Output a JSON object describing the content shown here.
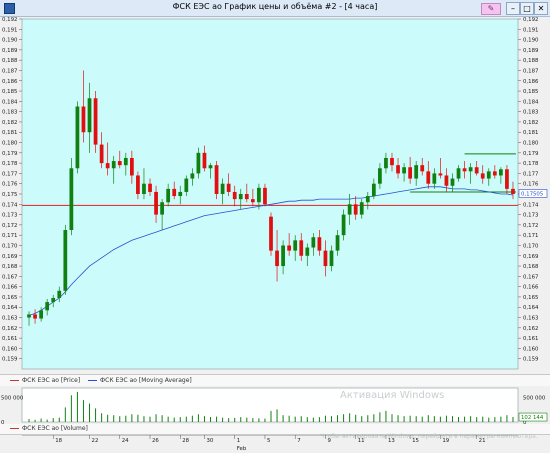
{
  "window": {
    "title": "ФСК ЕЭС ао График цены и объёма #2 - [4 часа]"
  },
  "toolbar": {
    "pen_icon": "pen-icon",
    "minimize": "–",
    "maximize": "□",
    "close": "✕"
  },
  "legend": {
    "price_label": "ФСК ЕЭС ао [Price]",
    "ma_label": "ФСК ЕЭС ао [Moving Average]",
    "volume_label": "ФСК ЕЭС ао [Volume]",
    "price_color": "#c0392b",
    "ma_color": "#2a4fd1"
  },
  "watermark": {
    "line1": "Активация Windows",
    "line2": "Чтобы активировать Windows, перейдите в параметры компьютера."
  },
  "colors": {
    "plot_bg": "#ccfbfb",
    "up": "#108010",
    "down": "#e01010",
    "level_red": "#e02020",
    "level_green": "#108010"
  },
  "chart_data": {
    "type": "candlestick",
    "ylim": [
      0.158,
      0.192
    ],
    "y_ticks": [
      "0,192",
      "0,191",
      "0,190",
      "0,189",
      "0,188",
      "0,187",
      "0,186",
      "0,185",
      "0,184",
      "0,183",
      "0,182",
      "0,181",
      "0,180",
      "0,179",
      "0,178",
      "0,177",
      "0,176",
      "0,175",
      "0,174",
      "0,173",
      "0,172",
      "0,171",
      "0,170",
      "0,169",
      "0,168",
      "0,167",
      "0,166",
      "0,165",
      "0,164",
      "0,163",
      "0,162",
      "0,161",
      "0,160",
      "0,159"
    ],
    "last_price_label": "0,17505",
    "horizontal_line_red": 0.1739,
    "green_levels": [
      {
        "from_index": 72,
        "to_index": 88,
        "value": 0.1789
      },
      {
        "from_index": 63,
        "to_index": 88,
        "value": 0.1752
      }
    ],
    "ohlc": [
      [
        0.163,
        0.1636,
        0.1622,
        0.1633
      ],
      [
        0.1633,
        0.1638,
        0.1624,
        0.1629
      ],
      [
        0.1629,
        0.164,
        0.1626,
        0.1637
      ],
      [
        0.1637,
        0.1648,
        0.1632,
        0.1645
      ],
      [
        0.1645,
        0.1652,
        0.164,
        0.1649
      ],
      [
        0.1649,
        0.166,
        0.1645,
        0.1656
      ],
      [
        0.1656,
        0.172,
        0.1652,
        0.1715
      ],
      [
        0.1715,
        0.1785,
        0.171,
        0.1775
      ],
      [
        0.1775,
        0.184,
        0.177,
        0.1835
      ],
      [
        0.1835,
        0.187,
        0.18,
        0.181
      ],
      [
        0.181,
        0.1858,
        0.179,
        0.1843
      ],
      [
        0.1843,
        0.185,
        0.179,
        0.1798
      ],
      [
        0.1798,
        0.181,
        0.1775,
        0.178
      ],
      [
        0.178,
        0.18,
        0.1768,
        0.1775
      ],
      [
        0.1775,
        0.1787,
        0.176,
        0.1782
      ],
      [
        0.1782,
        0.1792,
        0.1775,
        0.1778
      ],
      [
        0.1778,
        0.179,
        0.1768,
        0.1785
      ],
      [
        0.1785,
        0.1792,
        0.176,
        0.1768
      ],
      [
        0.1768,
        0.1772,
        0.1745,
        0.175
      ],
      [
        0.175,
        0.1775,
        0.1745,
        0.176
      ],
      [
        0.176,
        0.1765,
        0.1748,
        0.1752
      ],
      [
        0.1752,
        0.1758,
        0.1722,
        0.173
      ],
      [
        0.173,
        0.1745,
        0.1715,
        0.1742
      ],
      [
        0.1742,
        0.176,
        0.1738,
        0.1755
      ],
      [
        0.1755,
        0.1762,
        0.1745,
        0.1748
      ],
      [
        0.1748,
        0.1758,
        0.174,
        0.1752
      ],
      [
        0.1752,
        0.1768,
        0.1748,
        0.1765
      ],
      [
        0.1765,
        0.1775,
        0.1758,
        0.177
      ],
      [
        0.177,
        0.1795,
        0.1765,
        0.179
      ],
      [
        0.179,
        0.1797,
        0.1772,
        0.1775
      ],
      [
        0.1775,
        0.178,
        0.1765,
        0.1778
      ],
      [
        0.1778,
        0.1782,
        0.1745,
        0.175
      ],
      [
        0.175,
        0.1765,
        0.174,
        0.176
      ],
      [
        0.176,
        0.177,
        0.1748,
        0.1752
      ],
      [
        0.1752,
        0.1758,
        0.1738,
        0.1745
      ],
      [
        0.1745,
        0.1755,
        0.1735,
        0.175
      ],
      [
        0.175,
        0.176,
        0.1742,
        0.1745
      ],
      [
        0.1745,
        0.1755,
        0.1738,
        0.1742
      ],
      [
        0.1742,
        0.176,
        0.1735,
        0.1756
      ],
      [
        0.1756,
        0.176,
        0.1738,
        0.174
      ],
      [
        0.1728,
        0.1732,
        0.169,
        0.1695
      ],
      [
        0.1695,
        0.1715,
        0.1665,
        0.168
      ],
      [
        0.168,
        0.1705,
        0.1672,
        0.17
      ],
      [
        0.17,
        0.1712,
        0.169,
        0.1695
      ],
      [
        0.1695,
        0.171,
        0.1685,
        0.1705
      ],
      [
        0.1705,
        0.1712,
        0.1685,
        0.169
      ],
      [
        0.169,
        0.1702,
        0.168,
        0.1698
      ],
      [
        0.1698,
        0.1712,
        0.169,
        0.1708
      ],
      [
        0.1708,
        0.1715,
        0.169,
        0.1695
      ],
      [
        0.1695,
        0.1705,
        0.167,
        0.168
      ],
      [
        0.168,
        0.17,
        0.1675,
        0.1695
      ],
      [
        0.1695,
        0.1715,
        0.169,
        0.171
      ],
      [
        0.171,
        0.1735,
        0.1705,
        0.173
      ],
      [
        0.173,
        0.175,
        0.172,
        0.174
      ],
      [
        0.174,
        0.1748,
        0.1725,
        0.173
      ],
      [
        0.173,
        0.1745,
        0.1726,
        0.1742
      ],
      [
        0.1742,
        0.1752,
        0.1735,
        0.1748
      ],
      [
        0.1748,
        0.1765,
        0.1745,
        0.176
      ],
      [
        0.176,
        0.178,
        0.1755,
        0.1775
      ],
      [
        0.1775,
        0.179,
        0.177,
        0.1785
      ],
      [
        0.1785,
        0.179,
        0.1772,
        0.1778
      ],
      [
        0.1778,
        0.1785,
        0.1765,
        0.177
      ],
      [
        0.177,
        0.178,
        0.1762,
        0.1776
      ],
      [
        0.1776,
        0.1786,
        0.176,
        0.1765
      ],
      [
        0.1765,
        0.1782,
        0.1758,
        0.1778
      ],
      [
        0.1778,
        0.1785,
        0.1768,
        0.1772
      ],
      [
        0.1772,
        0.1782,
        0.1755,
        0.176
      ],
      [
        0.176,
        0.1775,
        0.1755,
        0.177
      ],
      [
        0.177,
        0.1785,
        0.1765,
        0.1768
      ],
      [
        0.1768,
        0.1775,
        0.1752,
        0.1758
      ],
      [
        0.1758,
        0.177,
        0.1752,
        0.1765
      ],
      [
        0.1765,
        0.1778,
        0.1762,
        0.1775
      ],
      [
        0.1775,
        0.1782,
        0.1765,
        0.1772
      ],
      [
        0.1772,
        0.178,
        0.176,
        0.1776
      ],
      [
        0.1776,
        0.1782,
        0.1768,
        0.177
      ],
      [
        0.177,
        0.1778,
        0.176,
        0.1765
      ],
      [
        0.1765,
        0.1775,
        0.1758,
        0.1772
      ],
      [
        0.1772,
        0.1778,
        0.1765,
        0.1768
      ],
      [
        0.1768,
        0.1776,
        0.176,
        0.1774
      ],
      [
        0.1774,
        0.1778,
        0.175,
        0.1755
      ],
      [
        0.1755,
        0.1762,
        0.1745,
        0.175
      ]
    ],
    "moving_average": [
      0.1632,
      0.1634,
      0.1637,
      0.1641,
      0.1645,
      0.1649,
      0.1655,
      0.1662,
      0.1668,
      0.1674,
      0.168,
      0.1684,
      0.1688,
      0.1692,
      0.1696,
      0.1699,
      0.1702,
      0.1705,
      0.1707,
      0.1709,
      0.1711,
      0.1713,
      0.1715,
      0.1717,
      0.1719,
      0.1721,
      0.1723,
      0.1725,
      0.1727,
      0.1729,
      0.173,
      0.1731,
      0.1732,
      0.1733,
      0.1734,
      0.1735,
      0.1736,
      0.1737,
      0.1738,
      0.1739,
      0.174,
      0.1741,
      0.1742,
      0.1743,
      0.1743,
      0.1744,
      0.1744,
      0.1744,
      0.1745,
      0.1745,
      0.1745,
      0.1745,
      0.1745,
      0.1745,
      0.1746,
      0.1746,
      0.1747,
      0.1748,
      0.1749,
      0.175,
      0.1751,
      0.1752,
      0.1753,
      0.1754,
      0.1755,
      0.1756,
      0.1757,
      0.1757,
      0.1757,
      0.1756,
      0.1755,
      0.1755,
      0.1755,
      0.1754,
      0.1754,
      0.1753,
      0.1752,
      0.1751,
      0.175,
      0.175,
      0.1749
    ],
    "volume": {
      "y_ticks": [
        "500 000",
        "0"
      ],
      "last_label": "102 144",
      "values": [
        60000,
        45000,
        70000,
        50000,
        80000,
        90000,
        300000,
        550000,
        620000,
        450000,
        380000,
        280000,
        180000,
        150000,
        140000,
        120000,
        130000,
        160000,
        150000,
        120000,
        110000,
        160000,
        140000,
        110000,
        90000,
        100000,
        110000,
        130000,
        160000,
        120000,
        100000,
        110000,
        90000,
        80000,
        85000,
        100000,
        90000,
        80000,
        75000,
        70000,
        230000,
        260000,
        140000,
        130000,
        110000,
        120000,
        100000,
        90000,
        100000,
        130000,
        120000,
        140000,
        160000,
        180000,
        150000,
        120000,
        140000,
        160000,
        200000,
        230000,
        160000,
        140000,
        120000,
        130000,
        120000,
        110000,
        140000,
        120000,
        110000,
        130000,
        120000,
        100000,
        110000,
        120000,
        100000,
        110000,
        90000,
        100000,
        110000,
        140000,
        102144
      ]
    },
    "x_ticks": [
      {
        "label": "18",
        "index": 4
      },
      {
        "label": "22",
        "index": 10
      },
      {
        "label": "24",
        "index": 15
      },
      {
        "label": "26",
        "index": 20
      },
      {
        "label": "28",
        "index": 25
      },
      {
        "label": "30",
        "index": 29
      },
      {
        "label": "1",
        "index": 34
      },
      {
        "label": "5",
        "index": 39
      },
      {
        "label": "7",
        "index": 44
      },
      {
        "label": "9",
        "index": 49
      },
      {
        "label": "11",
        "index": 54
      },
      {
        "label": "13",
        "index": 59
      },
      {
        "label": "15",
        "index": 63
      },
      {
        "label": "19",
        "index": 68
      },
      {
        "label": "21",
        "index": 74
      }
    ],
    "month_label": {
      "label": "Feb",
      "index": 34
    }
  }
}
